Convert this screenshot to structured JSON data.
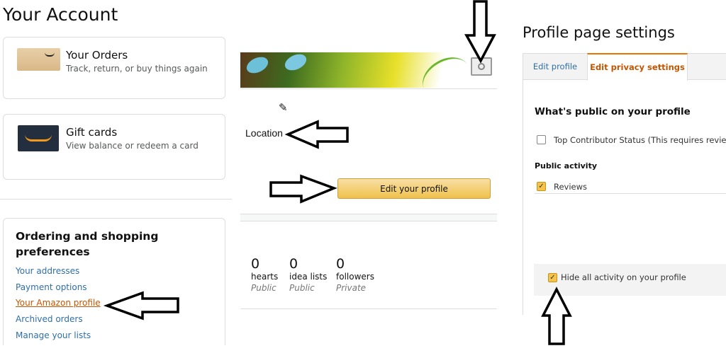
{
  "page_title": "Your Account",
  "cards": [
    {
      "title": "Your Orders",
      "subtitle": "Track, return, or buy things again",
      "icon": "package-box-icon"
    },
    {
      "title": "Gift cards",
      "subtitle": "View balance or redeem a card",
      "icon": "gift-card-icon"
    }
  ],
  "preferences": {
    "title": "Ordering and shopping preferences",
    "links": [
      "Your addresses",
      "Payment options",
      "Your Amazon profile",
      "Archived orders",
      "Manage your lists"
    ],
    "active_link": "Your Amazon profile"
  },
  "profile": {
    "location": "Location",
    "edit_button": "Edit your profile",
    "stats": [
      {
        "count": "0",
        "label": "hearts",
        "visibility": "Public"
      },
      {
        "count": "0",
        "label": "idea lists",
        "visibility": "Public"
      },
      {
        "count": "0",
        "label": "followers",
        "visibility": "Private"
      }
    ]
  },
  "settings": {
    "title": "Profile page settings",
    "tabs": [
      {
        "label": "Edit profile",
        "active": false
      },
      {
        "label": "Edit privacy settings",
        "active": true
      }
    ],
    "heading": "What's public on your profile",
    "top_contributor": {
      "label": "Top Contributor Status (This requires reviews a",
      "checked": false
    },
    "public_activity_label": "Public activity",
    "reviews": {
      "label": "Reviews",
      "checked": true
    },
    "hide_all": {
      "label": "Hide all activity on your profile",
      "checked": true
    }
  },
  "colors": {
    "accent": "#c45500",
    "link": "#2f6fa8",
    "button": "#f3c453"
  }
}
